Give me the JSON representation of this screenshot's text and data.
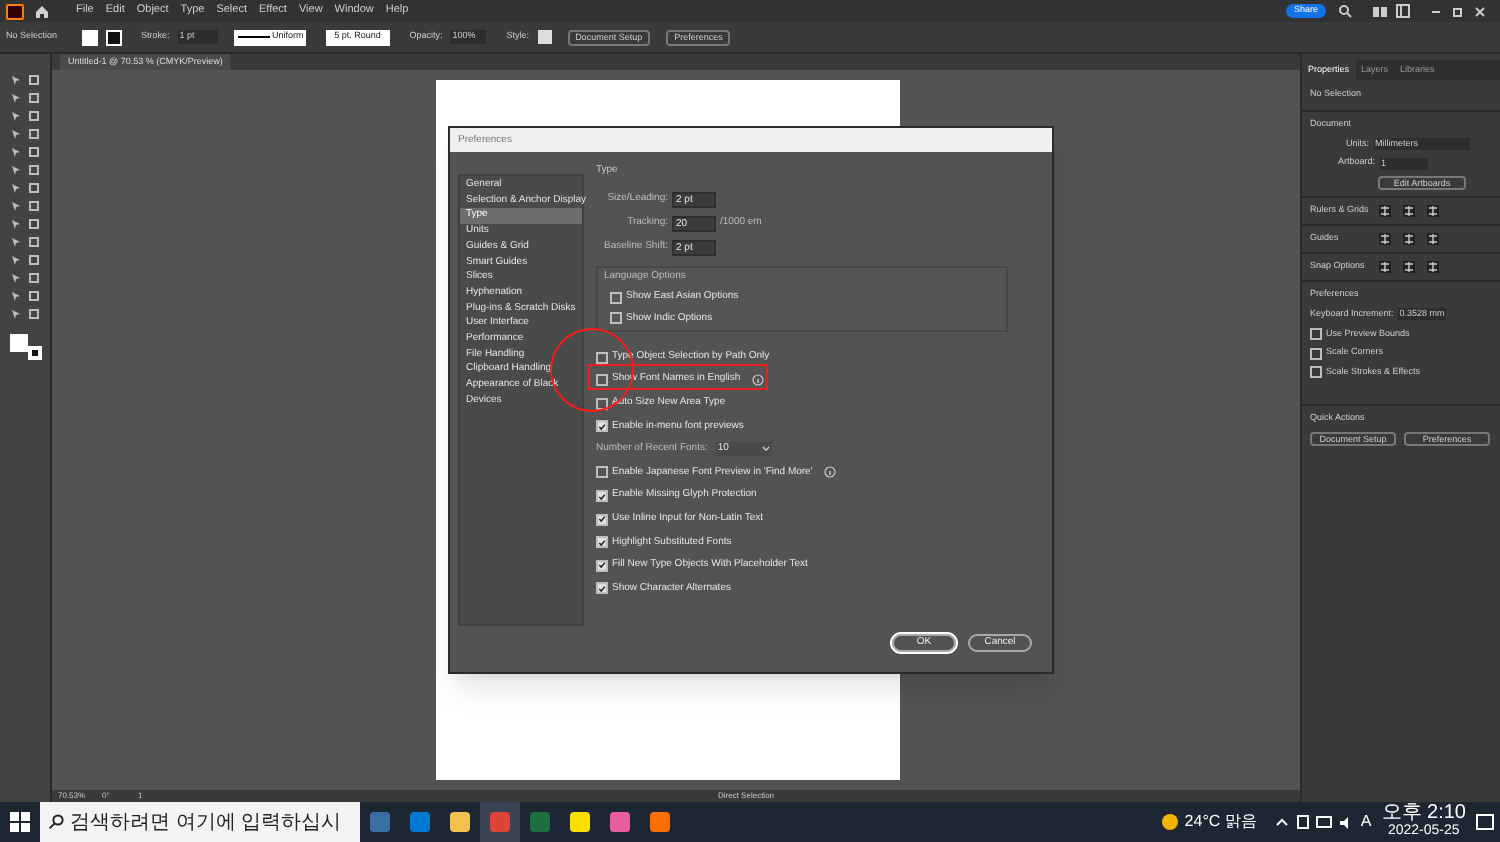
{
  "menu_bar": {
    "items": [
      "File",
      "Edit",
      "Object",
      "Type",
      "Select",
      "Effect",
      "View",
      "Window",
      "Help"
    ],
    "share": "Share"
  },
  "control_bar": {
    "selection": "No Selection",
    "stroke_label": "Stroke:",
    "stroke_value": "1 pt",
    "profile": "Uniform",
    "brush": "5 pt. Round",
    "opacity_label": "Opacity:",
    "opacity_value": "100%",
    "style_label": "Style:",
    "buttons": [
      "Document Setup",
      "Preferences"
    ]
  },
  "document_tab": {
    "title": "Untitled-1 @ 70.53 % (CMYK/Preview)"
  },
  "dialog": {
    "title": "Preferences",
    "categories": [
      {
        "label": "General",
        "selected": false
      },
      {
        "label": "Selection & Anchor Display",
        "selected": false
      },
      {
        "label": "Type",
        "selected": true
      },
      {
        "label": "Units",
        "selected": false
      },
      {
        "label": "Guides & Grid",
        "selected": false
      },
      {
        "label": "Smart Guides",
        "selected": false
      },
      {
        "label": "Slices",
        "selected": false
      },
      {
        "label": "Hyphenation",
        "selected": false
      },
      {
        "label": "Plug-ins & Scratch Disks",
        "selected": false
      },
      {
        "label": "User Interface",
        "selected": false
      },
      {
        "label": "Performance",
        "selected": false
      },
      {
        "label": "File Handling",
        "selected": false
      },
      {
        "label": "Clipboard Handling",
        "selected": false
      },
      {
        "label": "Appearance of Black",
        "selected": false
      },
      {
        "label": "Devices",
        "selected": false
      }
    ],
    "heading": "Type",
    "fields": [
      {
        "label": "Size/Leading:",
        "value": "2 pt"
      },
      {
        "label": "Tracking:",
        "value": "20",
        "unit": "/1000 em"
      },
      {
        "label": "Baseline Shift:",
        "value": "2 pt"
      }
    ],
    "language_options": {
      "title": "Language Options",
      "options": [
        {
          "label": "Show East Asian Options",
          "checked": false
        },
        {
          "label": "Show Indic Options",
          "checked": false
        }
      ]
    },
    "options": [
      {
        "kind": "checkbox",
        "label": "Type Object Selection by Path Only",
        "checked": false,
        "info": false
      },
      {
        "kind": "checkbox",
        "label": "Show Font Names in English",
        "checked": false,
        "info": true
      },
      {
        "kind": "checkbox",
        "label": "Auto Size New Area Type",
        "checked": false,
        "info": false
      },
      {
        "kind": "checkbox",
        "label": "Enable in-menu font previews",
        "checked": true,
        "info": false
      },
      {
        "kind": "select",
        "label": "Number of Recent Fonts:",
        "value": "10"
      },
      {
        "kind": "checkbox",
        "label": "Enable Japanese Font Preview in 'Find More'",
        "checked": false,
        "info": true
      },
      {
        "kind": "checkbox",
        "label": "Enable Missing Glyph Protection",
        "checked": true,
        "info": false
      },
      {
        "kind": "checkbox",
        "label": "Use Inline Input for Non-Latin Text",
        "checked": true,
        "info": false
      },
      {
        "kind": "checkbox",
        "label": "Highlight Substituted Fonts",
        "checked": true,
        "info": false
      },
      {
        "kind": "checkbox",
        "label": "Fill New Type Objects With Placeholder Text",
        "checked": true,
        "info": false
      },
      {
        "kind": "checkbox",
        "label": "Show Character Alternates",
        "checked": true,
        "info": false
      }
    ],
    "buttons": [
      "OK",
      "Cancel"
    ]
  },
  "properties_panel": {
    "tabs": [
      {
        "label": "Properties",
        "selected": true
      },
      {
        "label": "Layers",
        "selected": false
      },
      {
        "label": "Libraries",
        "selected": false
      }
    ],
    "selection": "No Selection",
    "document_title": "Document",
    "units_label": "Units:",
    "units_value": "Millimeters",
    "artboard_label": "Artboard:",
    "artboard_value": "1",
    "edit_artboards": "Edit Artboards",
    "rows": [
      "Rulers & Grids",
      "Guides",
      "Snap Options"
    ],
    "preferences_title": "Preferences",
    "increment_label": "Keyboard Increment:",
    "increment_value": "0.3528 mm",
    "checkboxes": [
      {
        "label": "Use Preview Bounds",
        "checked": false
      },
      {
        "label": "Scale Corners",
        "checked": false
      },
      {
        "label": "Scale Strokes & Effects",
        "checked": false
      }
    ],
    "quick_actions_title": "Quick Actions",
    "buttons": [
      "Document Setup",
      "Preferences"
    ]
  },
  "status_bar": {
    "zoom": "70.53%",
    "rotation": "0°",
    "artboard": "1",
    "tool": "Direct Selection"
  },
  "taskbar": {
    "search_placeholder": "검색하려면 여기에 입력하십시",
    "weather": "24°C 맑음",
    "ime": "A",
    "time": "오후 2:10",
    "date": "2022-05-25"
  }
}
